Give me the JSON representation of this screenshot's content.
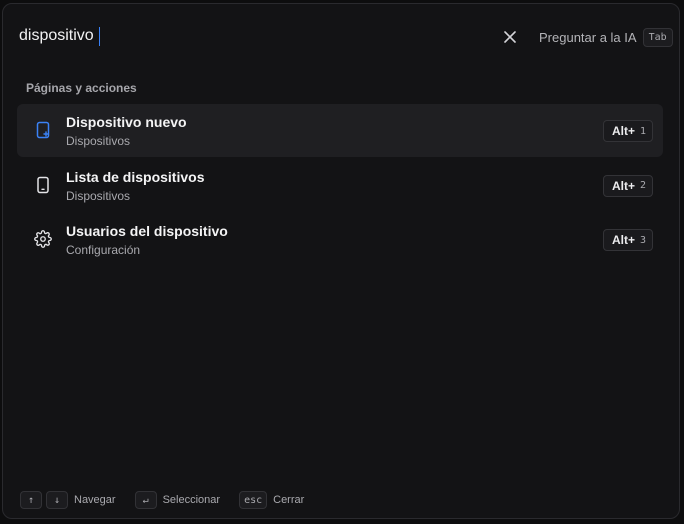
{
  "search": {
    "value": "dispositivo",
    "clear_icon": "close-icon",
    "ask_ai_label": "Preguntar a la IA",
    "ask_ai_key": "Tab"
  },
  "section": {
    "title": "Páginas y acciones"
  },
  "results": [
    {
      "title": "Dispositivo nuevo",
      "subtitle": "Dispositivos",
      "icon": "new-device-icon",
      "shortcut_mod": "Alt+",
      "shortcut_num": "1",
      "active": true
    },
    {
      "title": "Lista de dispositivos",
      "subtitle": "Dispositivos",
      "icon": "phone-icon",
      "shortcut_mod": "Alt+",
      "shortcut_num": "2",
      "active": false
    },
    {
      "title": "Usuarios del dispositivo",
      "subtitle": "Configuración",
      "icon": "gear-icon",
      "shortcut_mod": "Alt+",
      "shortcut_num": "3",
      "active": false
    }
  ],
  "footer": {
    "up_key": "↑",
    "down_key": "↓",
    "navigate_label": "Navegar",
    "enter_key": "↵",
    "select_label": "Seleccionar",
    "esc_key": "esc",
    "close_label": "Cerrar"
  },
  "colors": {
    "accent": "#3b82f6",
    "background": "#131315",
    "active_row": "#1f1f22"
  }
}
